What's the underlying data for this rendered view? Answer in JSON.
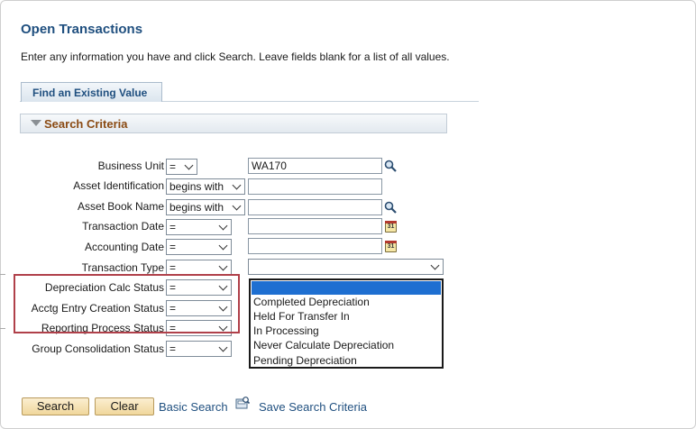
{
  "page": {
    "title": "Open Transactions",
    "instructions": "Enter any information you have and click Search. Leave fields blank for a list of all values."
  },
  "tabs": [
    {
      "label": "Find an Existing Value"
    }
  ],
  "section": {
    "label": "Search Criteria"
  },
  "fields": [
    {
      "label": "Business Unit",
      "operator": "=",
      "value": "WA170"
    },
    {
      "label": "Asset Identification",
      "operator": "begins with",
      "value": ""
    },
    {
      "label": "Asset Book Name",
      "operator": "begins with",
      "value": ""
    },
    {
      "label": "Transaction Date",
      "operator": "=",
      "value": ""
    },
    {
      "label": "Accounting Date",
      "operator": "=",
      "value": ""
    },
    {
      "label": "Transaction Type",
      "operator": "=",
      "value": ""
    },
    {
      "label": "Depreciation Calc Status",
      "operator": "=",
      "value": ""
    },
    {
      "label": "Acctg Entry Creation Status",
      "operator": "=",
      "value": ""
    },
    {
      "label": "Reporting Process Status",
      "operator": "=",
      "value": ""
    },
    {
      "label": "Group Consolidation Status",
      "operator": "=",
      "value": ""
    }
  ],
  "dropdown": {
    "options": [
      "",
      "Completed Depreciation",
      "Held For Transfer In",
      "In Processing",
      "Never Calculate Depreciation",
      "Pending Depreciation"
    ]
  },
  "calendar_icon_text": "31",
  "buttons": {
    "search": "Search",
    "clear": "Clear",
    "basic_search": "Basic Search",
    "save_search": "Save Search Criteria"
  },
  "colors": {
    "title": "#1f4f7f",
    "section_label": "#8a4a12",
    "highlight": "#1e6fd1",
    "annotation_box": "#b0404a",
    "button_fill": "#f0d79c"
  }
}
